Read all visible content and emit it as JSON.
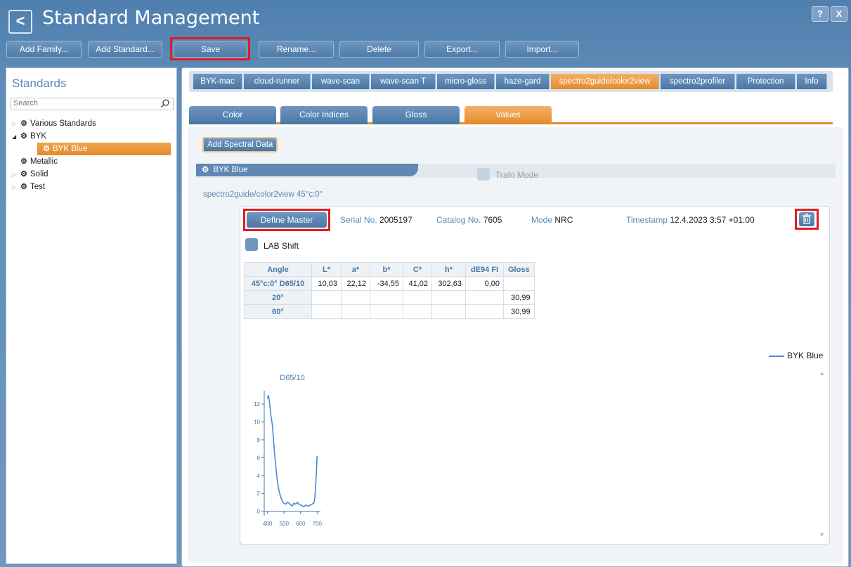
{
  "header": {
    "back_glyph": "<",
    "title": "Standard Management",
    "help_label": "?",
    "close_label": "X"
  },
  "toolbar": {
    "add_family": "Add Family...",
    "add_standard": "Add Standard...",
    "save": "Save",
    "rename": "Rename...",
    "delete": "Delete",
    "export": "Export...",
    "import": "Import..."
  },
  "sidebar": {
    "title": "Standards",
    "search_placeholder": "Search",
    "tree": {
      "various": "Various Standards",
      "byk": "BYK",
      "byk_blue": "BYK Blue",
      "metallic": "Metallic",
      "solid": "Solid",
      "test": "Test"
    }
  },
  "device_tabs": [
    "BYK-mac",
    "cloud-runner",
    "wave-scan",
    "wave-scan T",
    "micro-gloss",
    "haze-gard",
    "spectro2guide/color2view",
    "spectro2profiler",
    "Protection",
    "Info"
  ],
  "sub_tabs": [
    "Color",
    "Color Indices",
    "Gloss",
    "Values"
  ],
  "content": {
    "add_spectral": "Add Spectral Data",
    "standard_name": "BYK Blue",
    "trafo_mode": "Trafo Mode",
    "measurement_label": "spectro2guide/color2view 45°c:0°",
    "define_master": "Define Master",
    "serial_label": "Serial No.",
    "serial_value": "2005197",
    "catalog_label": "Catalog No.",
    "catalog_value": "7605",
    "mode_label": "Mode",
    "mode_value": "NRC",
    "timestamp_label": "Timestamp",
    "timestamp_value": "12.4.2023 3:57  +01:00",
    "lab_shift": "LAB Shift"
  },
  "table": {
    "headers": [
      "Angle",
      "L*",
      "a*",
      "b*",
      "C*",
      "h*",
      "dE94 FI",
      "Gloss"
    ],
    "rows": [
      [
        "45°c:0° D65/10",
        "10,03",
        "22,12",
        "-34,55",
        "41,02",
        "302,63",
        "0,00",
        ""
      ],
      [
        "20°",
        "",
        "",
        "",
        "",
        "",
        "",
        "30,99"
      ],
      [
        "60°",
        "",
        "",
        "",
        "",
        "",
        "",
        "30,99"
      ]
    ]
  },
  "colors": {
    "accent": "#e48a2a",
    "primary": "#4a77a5",
    "line": "#4a8ad8",
    "highlight": "#e11b22"
  },
  "chart_data": {
    "type": "line",
    "title": "D65/10",
    "xlabel": "",
    "ylabel": "",
    "xlim": [
      380,
      720
    ],
    "ylim": [
      -0.5,
      13.5
    ],
    "xticks": [
      400,
      500,
      600,
      700
    ],
    "yticks": [
      0,
      2,
      4,
      6,
      8,
      10,
      12
    ],
    "legend": "top-right",
    "series": [
      {
        "name": "BYK Blue",
        "color": "#4a8ad8",
        "x": [
          400,
          405,
          410,
          415,
          420,
          425,
          430,
          435,
          440,
          450,
          460,
          470,
          480,
          490,
          500,
          510,
          520,
          530,
          540,
          550,
          560,
          570,
          580,
          590,
          600,
          610,
          620,
          630,
          640,
          650,
          660,
          670,
          680,
          685,
          690,
          695,
          700
        ],
        "y": [
          12.6,
          13.0,
          12.5,
          11.7,
          10.8,
          10.2,
          9.5,
          8.3,
          7.0,
          5.0,
          3.3,
          2.2,
          1.6,
          1.1,
          0.9,
          0.8,
          1.0,
          0.9,
          0.7,
          0.6,
          0.9,
          0.8,
          1.0,
          0.8,
          0.7,
          0.6,
          0.5,
          0.7,
          0.6,
          0.6,
          0.7,
          0.8,
          0.9,
          1.3,
          2.4,
          4.2,
          6.2
        ]
      }
    ]
  }
}
